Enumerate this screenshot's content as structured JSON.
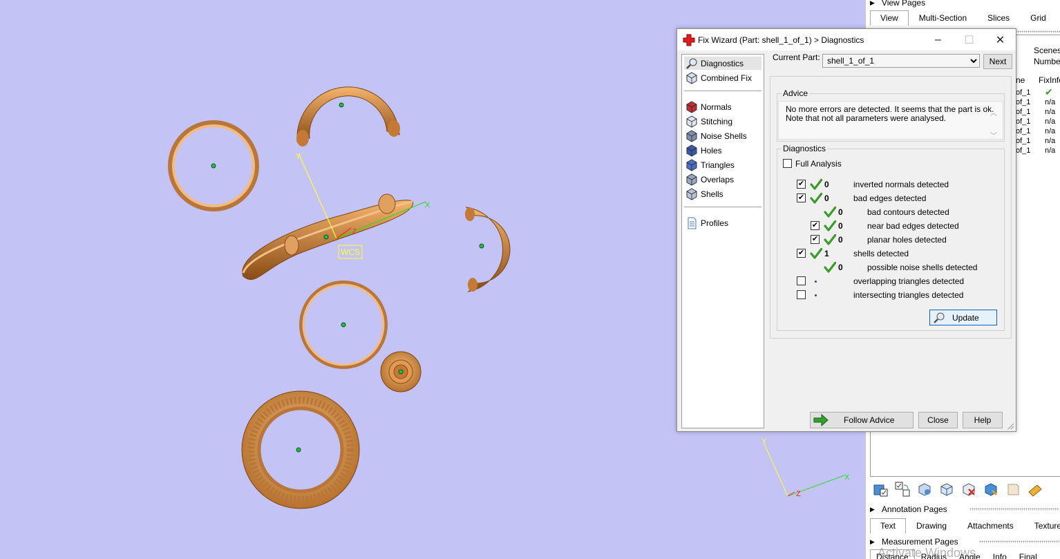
{
  "right_panel": {
    "view_pages_label": "View Pages",
    "view_tabs": [
      "View",
      "Multi-Section",
      "Slices",
      "Grid"
    ],
    "scenes_header": "Scenes",
    "number_header": "Number",
    "name_header_fragment": "ne",
    "fixinfo_header": "FixInfo",
    "rows": [
      {
        "name": "of_1",
        "fix": "✔"
      },
      {
        "name": "of_1",
        "fix": "n/a"
      },
      {
        "name": "of_1",
        "fix": "n/a"
      },
      {
        "name": "of_1",
        "fix": "n/a"
      },
      {
        "name": "of_1",
        "fix": "n/a"
      },
      {
        "name": "of_1",
        "fix": "n/a"
      },
      {
        "name": "of_1",
        "fix": "n/a"
      }
    ],
    "annotation_pages_label": "Annotation Pages",
    "annotation_tabs": [
      "Text",
      "Drawing",
      "Attachments",
      "Textures"
    ],
    "measurement_pages_label": "Measurement Pages",
    "measurement_tabs": [
      "Distance",
      "Radius",
      "Angle",
      "Info",
      "Final Part"
    ],
    "watermark": "Activate Windows"
  },
  "viewport": {
    "wcs_label": "WCS",
    "axis_x": "X",
    "axis_y": "Y",
    "axis_z": "Z"
  },
  "dialog": {
    "title": "Fix Wizard (Part: shell_1_of_1) > Diagnostics",
    "nav_top": [
      {
        "label": "Diagnostics",
        "icon": "magnifier-icon"
      },
      {
        "label": "Combined Fix",
        "icon": "cube-icon"
      }
    ],
    "nav_middle": [
      {
        "label": "Normals",
        "icon": "normals-cube-icon"
      },
      {
        "label": "Stitching",
        "icon": "stitching-cube-icon"
      },
      {
        "label": "Noise Shells",
        "icon": "noise-shells-icon"
      },
      {
        "label": "Holes",
        "icon": "holes-cube-icon"
      },
      {
        "label": "Triangles",
        "icon": "triangles-cube-icon"
      },
      {
        "label": "Overlaps",
        "icon": "overlaps-cube-icon"
      },
      {
        "label": "Shells",
        "icon": "shells-cube-icon"
      }
    ],
    "nav_bottom": [
      {
        "label": "Profiles",
        "icon": "profiles-document-icon"
      }
    ],
    "current_part_label": "Current Part:",
    "current_part_value": "shell_1_of_1",
    "next_label": "Next",
    "advice_title": "Advice",
    "advice_line1": "No more errors are detected. It seems that the part is ok.",
    "advice_line2": "Note that not all parameters were analysed.",
    "diagnostics_title": "Diagnostics",
    "full_analysis_label": "Full Analysis",
    "full_analysis_checked": false,
    "rows": [
      {
        "checkbox": true,
        "checked": true,
        "status": "ok",
        "count": "0",
        "label": "inverted normals detected",
        "indent": 0
      },
      {
        "checkbox": true,
        "checked": true,
        "status": "ok",
        "count": "0",
        "label": "bad edges detected",
        "indent": 0
      },
      {
        "checkbox": false,
        "checked": false,
        "status": "ok",
        "count": "0",
        "label": "bad contours detected",
        "indent": 1
      },
      {
        "checkbox": true,
        "checked": true,
        "status": "ok",
        "count": "0",
        "label": "near bad edges detected",
        "indent": 1
      },
      {
        "checkbox": true,
        "checked": true,
        "status": "ok",
        "count": "0",
        "label": "planar holes detected",
        "indent": 1
      },
      {
        "checkbox": true,
        "checked": true,
        "status": "ok",
        "count": "1",
        "label": "shells detected",
        "indent": 0
      },
      {
        "checkbox": false,
        "checked": false,
        "status": "ok",
        "count": "0",
        "label": "possible noise shells detected",
        "indent": 1
      },
      {
        "checkbox": true,
        "checked": false,
        "status": "dot",
        "count": "",
        "label": "overlapping triangles detected",
        "indent": 0
      },
      {
        "checkbox": true,
        "checked": false,
        "status": "dot",
        "count": "",
        "label": "intersecting triangles detected",
        "indent": 0
      }
    ],
    "update_label": "Update",
    "follow_advice_label": "Follow Advice",
    "close_label": "Close",
    "help_label": "Help"
  },
  "colors": {
    "viewport_bg": "#c4c3f6",
    "part_orange": "#e8a25a",
    "check_green": "#3a9a2a",
    "dot_blue": "#1a44c8"
  }
}
